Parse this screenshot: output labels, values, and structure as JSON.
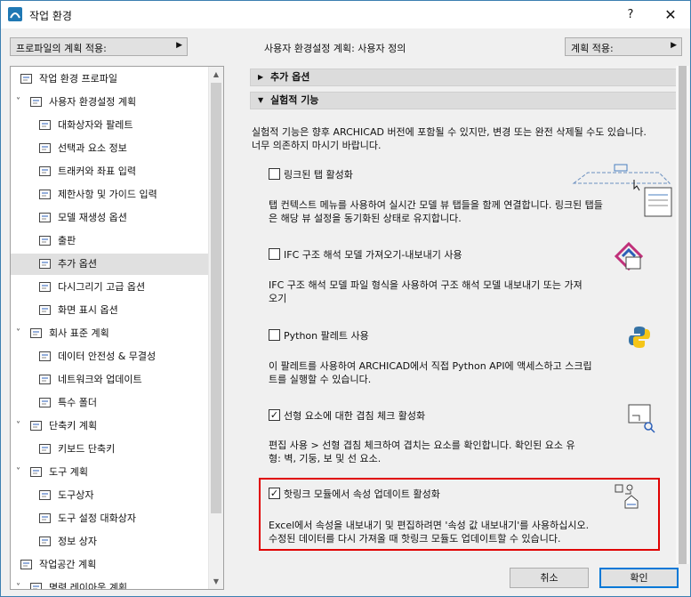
{
  "window": {
    "title": "작업 환경",
    "help": "?",
    "close": "✕"
  },
  "toolbar": {
    "apply_profile": "프로파일의 계획 적용:",
    "plan_label": "사용자 환경설정 계획: 사용자 정의",
    "apply_plan": "계획 적용:"
  },
  "tree": [
    {
      "label": "작업 환경 프로파일",
      "icon": "profile-icon",
      "indent": 0
    },
    {
      "label": "사용자 환경설정 계획",
      "icon": "user-prefs-icon",
      "indent": 0,
      "chevron": "˅"
    },
    {
      "label": "대화상자와 팔레트",
      "icon": "dialog-icon",
      "indent": 1
    },
    {
      "label": "선택과 요소 정보",
      "icon": "selection-icon",
      "indent": 1
    },
    {
      "label": "트래커와 좌표 입력",
      "icon": "xyz-icon",
      "indent": 1
    },
    {
      "label": "제한사항 및 가이드 입력",
      "icon": "cursor-icon",
      "indent": 1
    },
    {
      "label": "모델 재생성 옵션",
      "icon": "bricks-icon",
      "indent": 1
    },
    {
      "label": "출판",
      "icon": "publish-icon",
      "indent": 1
    },
    {
      "label": "추가 옵션",
      "icon": "sliders-icon",
      "indent": 1,
      "selected": true
    },
    {
      "label": "다시그리기 고급 옵션",
      "icon": "house-icon",
      "indent": 1
    },
    {
      "label": "화면 표시 옵션",
      "icon": "monitor-icon",
      "indent": 1
    },
    {
      "label": "회사 표준 계획",
      "icon": "company-icon",
      "indent": 0,
      "chevron": "˅"
    },
    {
      "label": "데이터 안전성 & 무결성",
      "icon": "data-icon",
      "indent": 1
    },
    {
      "label": "네트워크와 업데이트",
      "icon": "globe-icon",
      "indent": 1
    },
    {
      "label": "특수 폴더",
      "icon": "folder-icon",
      "indent": 1
    },
    {
      "label": "단축키 계획",
      "icon": "shortcut-icon",
      "indent": 0,
      "chevron": "˅"
    },
    {
      "label": "키보드 단축키",
      "icon": "keyboard-icon",
      "indent": 1
    },
    {
      "label": "도구 계획",
      "icon": "tools-icon",
      "indent": 0,
      "chevron": "˅"
    },
    {
      "label": "도구상자",
      "icon": "toolbox-icon",
      "indent": 1
    },
    {
      "label": "도구 설정 대화상자",
      "icon": "tool-settings-icon",
      "indent": 1
    },
    {
      "label": "정보 상자",
      "icon": "info-box-icon",
      "indent": 1
    },
    {
      "label": "작업공간 계획",
      "icon": "workspace-icon",
      "indent": 0
    },
    {
      "label": "명령 레이아웃 계획",
      "icon": "command-layout-icon",
      "indent": 0,
      "chevron": "˅"
    }
  ],
  "sections": {
    "extra": "추가 옵션",
    "experimental": "실험적 기능"
  },
  "intro": [
    "실험적 기능은 향후 ARCHICAD 버전에 포함될 수 있지만, 변경 또는 완전 삭제될 수도 있습니다.",
    "너무 의존하지 마시기 바랍니다."
  ],
  "features": [
    {
      "title": "링크된 탭 활성화",
      "checked": false,
      "desc": [
        "탭 컨텍스트 메뉴를 사용하여 실시간 모델 뷰 탭들을 함께 연결합니다. 링크된 탭들",
        "은 해당 뷰 설정을 동기화된 상태로 유지합니다."
      ]
    },
    {
      "title": "IFC 구조 해석 모델 가져오기-내보내기 사용",
      "checked": false,
      "desc": [
        "IFC 구조 해석 모델 파일 형식을 사용하여 구조 해석 모델 내보내기 또는 가져",
        "오기"
      ]
    },
    {
      "title": "Python 팔레트 사용",
      "checked": false,
      "desc": [
        "이 팔레트를 사용하여 ARCHICAD에서 직접 Python API에 액세스하고 스크립",
        "트를 실행할 수 있습니다."
      ]
    },
    {
      "title": "선형 요소에 대한 겹침 체크 활성화",
      "checked": true,
      "desc": [
        "편집 사용 > 선형 겹침 체크하여 겹치는 요소를 확인합니다. 확인된 요소 유",
        "형: 벽, 기둥, 보 및 선 요소."
      ]
    },
    {
      "title": "핫링크 모듈에서 속성 업데이트 활성화",
      "checked": true,
      "desc": [
        "Excel에서 속성을 내보내기 및 편집하려면 '속성 값 내보내기'를 사용하십시오.",
        "수정된 데이터를 다시 가져올 때 핫링크 모듈도 업데이트할 수 있습니다."
      ]
    }
  ],
  "buttons": {
    "cancel": "취소",
    "ok": "확인"
  },
  "colors": {
    "accent": "#0078d7",
    "highlight": "#e00000"
  }
}
